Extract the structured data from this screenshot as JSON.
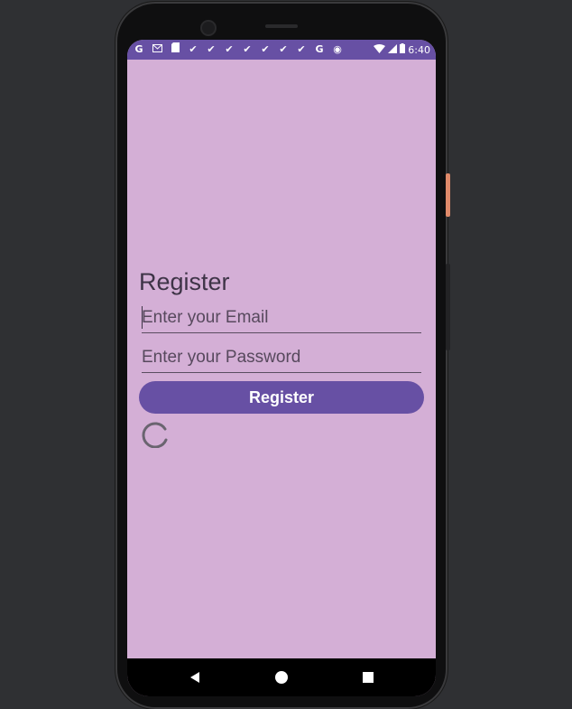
{
  "status_bar": {
    "time": "6:40",
    "notification_icons": [
      "google-g-icon",
      "gmail-icon",
      "sd-card-icon",
      "check-icon",
      "check-icon",
      "check-icon",
      "check-icon",
      "check-icon",
      "check-icon",
      "check-icon",
      "google-g-icon",
      "circle-icon"
    ],
    "colors": {
      "background": "#6750a4"
    }
  },
  "screen": {
    "title": "Register",
    "email_placeholder": "Enter your Email",
    "password_placeholder": "Enter your Password",
    "register_label": "Register",
    "colors": {
      "background": "#d4afd6",
      "accent": "#6750a4"
    }
  },
  "nav_bar": {
    "back_icon": "back-triangle-icon",
    "home_icon": "home-circle-icon",
    "recents_icon": "recents-square-icon"
  }
}
